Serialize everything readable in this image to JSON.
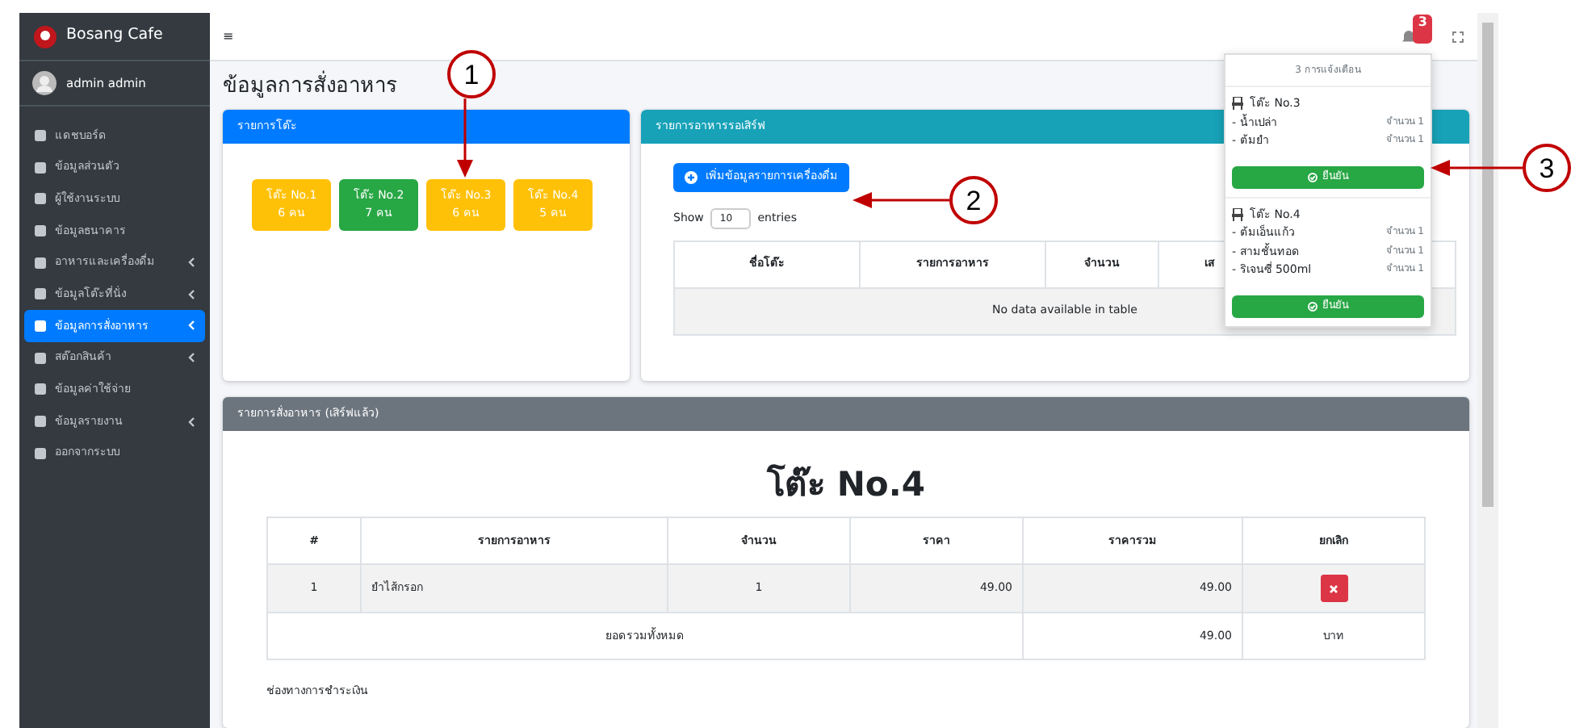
{
  "brand": "Bosang Cafe",
  "user": "admin admin",
  "sidebar": {
    "items": [
      {
        "label": "แดชบอร์ด",
        "selected": false,
        "submenu": false
      },
      {
        "label": "ข้อมูลส่วนตัว",
        "selected": false,
        "submenu": false
      },
      {
        "label": "ผู้ใช้งานระบบ",
        "selected": false,
        "submenu": false
      },
      {
        "label": "ข้อมูลธนาคาร",
        "selected": false,
        "submenu": false
      },
      {
        "label": "อาหารและเครื่องดื่ม",
        "selected": false,
        "submenu": true
      },
      {
        "label": "ข้อมูลโต๊ะที่นั่ง",
        "selected": false,
        "submenu": true
      },
      {
        "label": "ข้อมูลการสั่งอาหาร",
        "selected": true,
        "submenu": true
      },
      {
        "label": "สต๊อกสินค้า",
        "selected": false,
        "submenu": true
      },
      {
        "label": "ข้อมูลค่าใช้จ่าย",
        "selected": false,
        "submenu": false
      },
      {
        "label": "ข้อมูลรายงาน",
        "selected": false,
        "submenu": true
      },
      {
        "label": "ออกจากระบบ",
        "selected": false,
        "submenu": false
      }
    ]
  },
  "topbar": {
    "menu_glyph": "≡",
    "notification_count": "3"
  },
  "page_title": "ข้อมูลการสั่งอาหาร",
  "tables_card": {
    "title": "รายการโต๊ะ",
    "tables": [
      {
        "name": "โต๊ะ No.1",
        "people": "6 คน",
        "color": "#ffc107"
      },
      {
        "name": "โต๊ะ No.2",
        "people": "7 คน",
        "color": "#28a745"
      },
      {
        "name": "โต๊ะ No.3",
        "people": "6 คน",
        "color": "#ffc107"
      },
      {
        "name": "โต๊ะ No.4",
        "people": "5 คน",
        "color": "#ffc107"
      }
    ]
  },
  "waiting_card": {
    "title": "รายการอาหารรอเสิร์ฟ",
    "add_button": "เพิ่มข้อมูลรายการเครื่องดื่ม",
    "show_label": "Show",
    "page_size": "10",
    "entries_label": "entries",
    "columns": [
      "ชื่อโต๊ะ",
      "รายการอาหาร",
      "จำนวน",
      "เส"
    ],
    "empty_text": "No data available in table"
  },
  "notifications": {
    "header": "3 การแจ้งเตือน",
    "groups": [
      {
        "table": "โต๊ะ No.3",
        "items": [
          {
            "name": "- น้ำเปล่า",
            "qty": "จำนวน 1"
          },
          {
            "name": "- ต้มยำ",
            "qty": "จำนวน 1"
          }
        ],
        "button": "ยืนยัน"
      },
      {
        "table": "โต๊ะ No.4",
        "items": [
          {
            "name": "- ต้มเอ็นแก้ว",
            "qty": "จำนวน 1"
          },
          {
            "name": "- สามชั้นทอด",
            "qty": "จำนวน 1"
          },
          {
            "name": "- ริเจนซี่ 500ml",
            "qty": "จำนวน 1"
          }
        ],
        "button": "ยืนยัน"
      }
    ]
  },
  "served_card": {
    "title": "รายการสั่งอาหาร (เสิร์ฟแล้ว)",
    "table_heading": "โต๊ะ No.4",
    "columns": [
      "#",
      "รายการอาหาร",
      "จำนวน",
      "ราคา",
      "ราคารวม",
      "ยกเลิก"
    ],
    "rows": [
      {
        "no": "1",
        "item": "ยำไส้กรอก",
        "qty": "1",
        "price": "49.00",
        "total": "49.00"
      }
    ],
    "total_label": "ยอดรวมทั้งหมด",
    "total": "49.00",
    "currency": "บาท",
    "payment_label": "ช่องทางการชำระเงิน"
  },
  "annotations": [
    {
      "label": "1"
    },
    {
      "label": "2"
    },
    {
      "label": "3"
    }
  ]
}
